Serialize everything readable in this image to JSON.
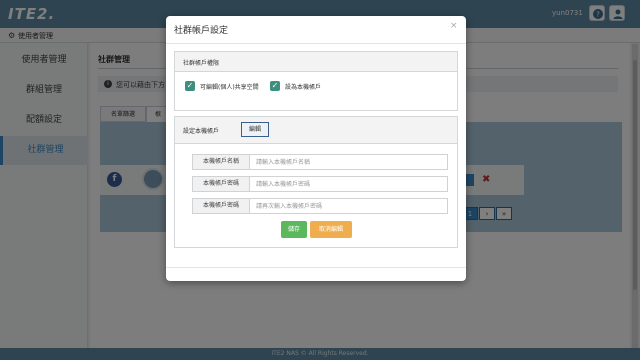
{
  "header": {
    "logo": "ITE2.",
    "username": "yun0731",
    "icons": [
      "help-icon",
      "user-icon"
    ]
  },
  "breadcrumb": {
    "icon": "gear-icon",
    "text": "使用者管理"
  },
  "sidebar": {
    "items": [
      {
        "label": "使用者管理",
        "active": false
      },
      {
        "label": "群組管理",
        "active": false
      },
      {
        "label": "配額設定",
        "active": false
      },
      {
        "label": "社群管理",
        "active": true
      }
    ]
  },
  "main": {
    "title": "社群管理",
    "info": "您可以藉由下方",
    "tabs": [
      {
        "label": "名單篩選"
      },
      {
        "label": "根"
      }
    ],
    "pager": {
      "current": "1",
      "next": "›",
      "last": "»"
    },
    "row_actions": {
      "delete": "✖"
    }
  },
  "modal": {
    "title": "社群帳戶設定",
    "close": "×",
    "permissions": {
      "heading": "社群帳戶權限",
      "options": [
        {
          "label": "可編輯(個人)共享空間",
          "checked": true
        },
        {
          "label": "設為本機帳戶",
          "checked": true
        }
      ]
    },
    "settings": {
      "heading": "設定本機帳戶",
      "edit_button": "編輯",
      "fields": [
        {
          "label": "本機帳戶名稱",
          "placeholder": "請輸入本機帳戶名稱",
          "value": ""
        },
        {
          "label": "本機帳戶密碼",
          "placeholder": "請輸入本機帳戶密碼",
          "value": ""
        },
        {
          "label": "本機帳戶密碼",
          "placeholder": "請再次輸入本機帳戶密碼",
          "value": ""
        }
      ],
      "save_button": "儲存",
      "cancel_button": "取消編輯"
    }
  },
  "footer": {
    "text": "ITE2 NAS © All Rights Reserved."
  },
  "colors": {
    "brand": "#5d88a3",
    "accent": "#3c8ac7",
    "save": "#5cb85c",
    "cancel": "#f0ad4e",
    "checkbox": "#3f8f7e"
  }
}
